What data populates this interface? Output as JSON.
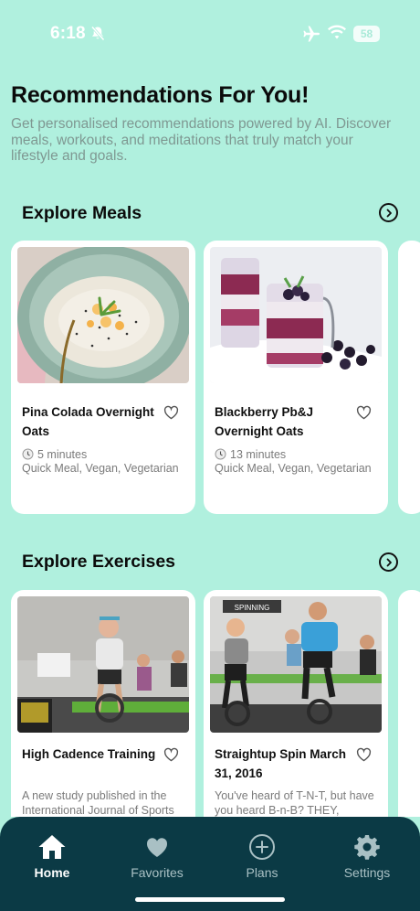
{
  "status_bar": {
    "time": "6:18",
    "battery": "58"
  },
  "header": {
    "title": "Recommendations For You!",
    "subtitle": "Get personalised recommendations powered by AI. Discover meals, workouts, and meditations that truly match your lifestyle and goals."
  },
  "meals": {
    "title": "Explore Meals",
    "items": [
      {
        "title": "Pina Colada Overnight Oats",
        "duration": "5 minutes",
        "tags": "Quick Meal, Vegan, Vegetarian"
      },
      {
        "title": "Blackberry Pb&J Overnight Oats",
        "duration": "13 minutes",
        "tags": "Quick Meal, Vegan, Vegetarian"
      }
    ]
  },
  "exercises": {
    "title": "Explore Exercises",
    "items": [
      {
        "title": "High Cadence Training",
        "description": "A new study published in the International Journal of Sports"
      },
      {
        "title": "Straightup Spin March 31, 2016",
        "description": "You've heard of T-N-T, but have you heard B-n-B? THEY,",
        "image_sign": "SPINNING"
      }
    ]
  },
  "nav": {
    "items": [
      {
        "label": "Home",
        "icon": "home-icon",
        "active": true
      },
      {
        "label": "Favorites",
        "icon": "heart-icon"
      },
      {
        "label": "Plans",
        "icon": "plus-circle-icon"
      },
      {
        "label": "Settings",
        "icon": "gear-icon"
      }
    ]
  },
  "colors": {
    "background": "#b0f0de",
    "nav_background": "#0b3a45",
    "card": "#ffffff",
    "subtitle": "#7f9892"
  }
}
